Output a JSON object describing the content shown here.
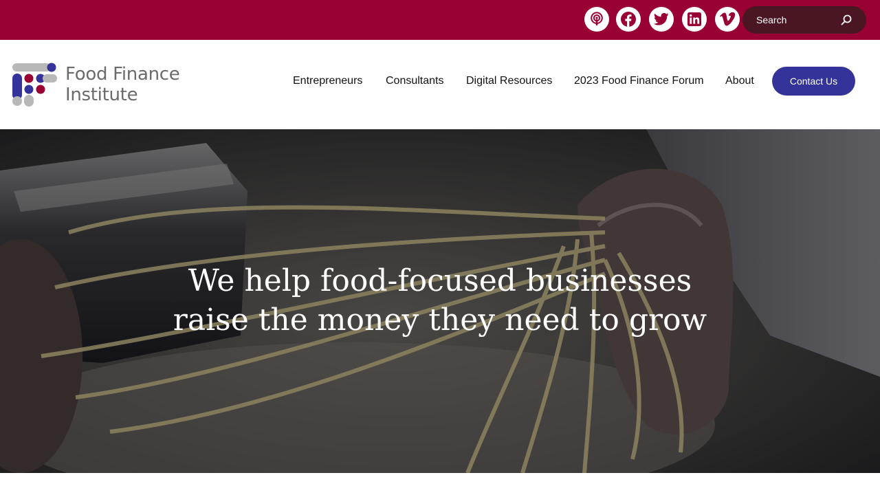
{
  "colors": {
    "topbar_bg": "#990033",
    "search_bg": "#4a1622",
    "accent_blue": "#333399",
    "logo_gray": "#6b6b6b",
    "logo_purple": "#333399",
    "logo_crimson": "#990033",
    "logo_light_gray": "#b8b8b8"
  },
  "social_links": [
    {
      "icon": "podcast-icon"
    },
    {
      "icon": "facebook-icon"
    },
    {
      "icon": "twitter-icon"
    },
    {
      "icon": "linkedin-icon"
    },
    {
      "icon": "vimeo-icon"
    }
  ],
  "search": {
    "placeholder": "Search",
    "icon": "search-icon"
  },
  "logo": {
    "line1": "Food Finance",
    "line2": "Institute"
  },
  "nav": {
    "items": [
      {
        "label": "Entrepreneurs"
      },
      {
        "label": "Consultants"
      },
      {
        "label": "Digital Resources"
      },
      {
        "label": "2023 Food Finance Forum"
      },
      {
        "label": "About"
      }
    ],
    "contact_label": "Contact Us"
  },
  "hero": {
    "title_line1": "We help food-focused businesses",
    "title_line2": "raise the money they need to grow"
  }
}
